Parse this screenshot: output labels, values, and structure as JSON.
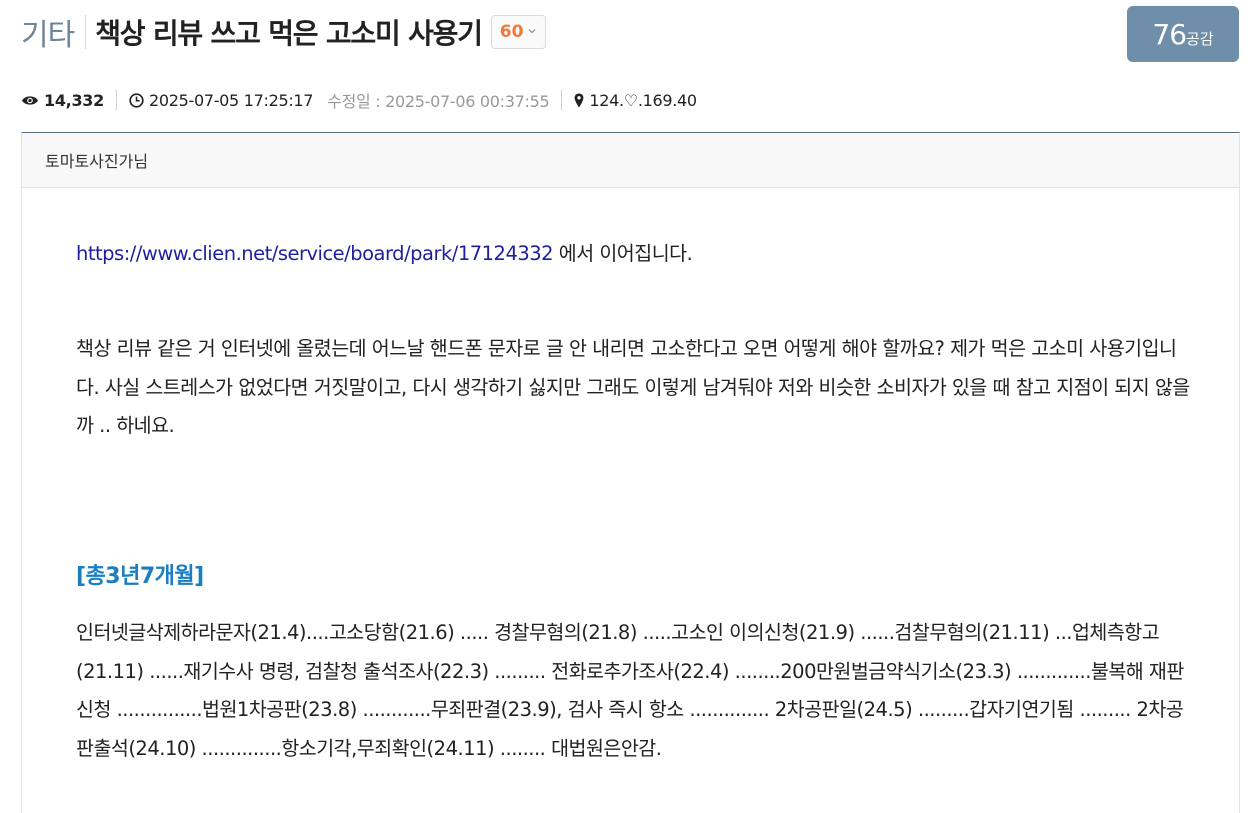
{
  "post": {
    "category": "기타",
    "title": "책상 리뷰 쓰고 먹은 고소미 사용기",
    "reply_count": "60",
    "symph_count": "76",
    "symph_label": "공감"
  },
  "meta": {
    "hits": "14,332",
    "date": "2025-07-05 17:25:17",
    "modified": "수정일 : 2025-07-06 00:37:55",
    "ip": "124.♡.169.40"
  },
  "author": {
    "nickname": "토마토사진가님"
  },
  "body": {
    "link_url": "https://www.clien.net/service/board/park/17124332",
    "link_suffix": " 에서 이어집니다.",
    "paragraph1": "책상 리뷰 같은 거 인터넷에 올렸는데 어느날 핸드폰 문자로 글 안 내리면 고소한다고 오면 어떻게 해야 할까요? 제가 먹은 고소미 사용기입니다. 사실 스트레스가 없었다면 거짓말이고, 다시 생각하기 싫지만 그래도 이렇게 남겨둬야 저와 비슷한 소비자가 있을 때 참고 지점이 되지 않을까 .. 하네요.",
    "heading": "[총3년7개월]",
    "timeline": "인터넷글삭제하라문자(21.4)....고소당함(21.6) ..... 경찰무혐의(21.8) .....고소인 이의신청(21.9) ......검찰무혐의(21.11) ...업체측항고(21.11) ......재기수사 명령, 검찰청 출석조사(22.3) ......... 전화로추가조사(22.4) ........200만원벌금약식기소(23.3) .............불복해 재판 신청 ...............법원1차공판(23.8) ............무죄판결(23.9), 검사 즉시 항소 .............. 2차공판일(24.5) .........갑자기연기됨 ......... 2차공판출석(24.10) ..............항소기각,무죄확인(24.11) ........ 대법원은안감."
  },
  "colors": {
    "category": "#6f8598",
    "reply_count": "#f07a3a",
    "symph_badge": "#6e8eaa",
    "link": "#1f1f9e",
    "heading": "#1a7ec1",
    "modified": "#999999"
  },
  "icons": [
    "eye-icon",
    "clock-icon",
    "map-marker-icon",
    "chevron-down-icon"
  ]
}
